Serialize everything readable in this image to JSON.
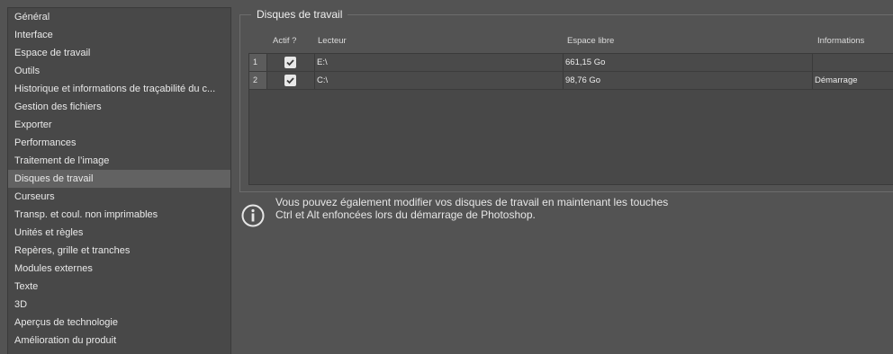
{
  "sidebar": {
    "items": [
      {
        "label": "Général"
      },
      {
        "label": "Interface"
      },
      {
        "label": "Espace de travail"
      },
      {
        "label": "Outils"
      },
      {
        "label": "Historique et informations de traçabilité du c..."
      },
      {
        "label": "Gestion des fichiers"
      },
      {
        "label": "Exporter"
      },
      {
        "label": "Performances"
      },
      {
        "label": "Traitement de l’image"
      },
      {
        "label": "Disques de travail",
        "selected": true
      },
      {
        "label": "Curseurs"
      },
      {
        "label": "Transp. et coul. non imprimables"
      },
      {
        "label": "Unités et règles"
      },
      {
        "label": "Repères, grille et tranches"
      },
      {
        "label": "Modules externes"
      },
      {
        "label": "Texte"
      },
      {
        "label": "3D"
      },
      {
        "label": "Aperçus de technologie"
      },
      {
        "label": "Amélioration du produit"
      }
    ]
  },
  "scratch": {
    "title": "Disques de travail",
    "columns": {
      "active": "Actif ?",
      "drive": "Lecteur",
      "space": "Espace libre",
      "info": "Informations"
    },
    "rows": [
      {
        "num": "1",
        "active": true,
        "drive": "E:\\",
        "space": "661,15 Go",
        "info": ""
      },
      {
        "num": "2",
        "active": true,
        "drive": "C:\\",
        "space": "98,76 Go",
        "info": "Démarrage"
      }
    ]
  },
  "note": {
    "icon": "info-icon",
    "text": "Vous pouvez également modifier vos disques de travail en maintenant les touches Ctrl et Alt enfoncées lors du démarrage de Photoshop."
  }
}
